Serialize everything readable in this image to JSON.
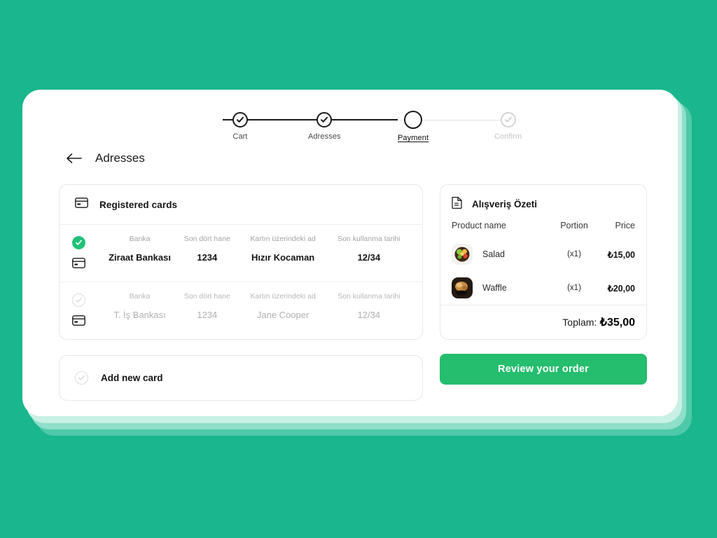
{
  "theme": {
    "background": "#1ab68e",
    "panel": "#ffffff",
    "accent_green": "#21c179",
    "button_green": "#25bd6e",
    "muted_text": "#a3a3a3"
  },
  "stepper": {
    "steps": [
      {
        "label": "Cart",
        "state": "completed",
        "icon": "check-icon"
      },
      {
        "label": "Adresses",
        "state": "completed",
        "icon": "check-icon"
      },
      {
        "label": "Payment",
        "state": "active",
        "icon": "empty-circle-icon"
      },
      {
        "label": "Confirm",
        "state": "upcoming",
        "icon": "check-icon"
      }
    ]
  },
  "header": {
    "back_icon": "arrow-left-icon",
    "title": "Adresses"
  },
  "registered_cards": {
    "icon": "credit-card-icon",
    "title": "Registered cards",
    "columns": [
      "Banka",
      "Son dört hane",
      "Kartın üzerindeki ad",
      "Son kullanma tarihi"
    ],
    "rows": [
      {
        "selected": true,
        "bank": "Ziraat Bankası",
        "last_four": "1234",
        "name_on_card": "Hızır Kocaman",
        "expiry": "12/34"
      },
      {
        "selected": false,
        "bank": "T. İş Bankası",
        "last_four": "1234",
        "name_on_card": "Jane Cooper",
        "expiry": "12/34"
      }
    ]
  },
  "add_new_card": {
    "icon": "check-circle-outline-icon",
    "label": "Add new card"
  },
  "summary": {
    "icon": "document-icon",
    "title": "Alışveriş Özeti",
    "columns": {
      "name": "Product name",
      "portion": "Portion",
      "price": "Price"
    },
    "items": [
      {
        "name": "Salad",
        "portion": "(x1)",
        "price": "₺15,00",
        "thumb": "salad-photo"
      },
      {
        "name": "Waffle",
        "portion": "(x1)",
        "price": "₺20,00",
        "thumb": "waffle-photo"
      }
    ],
    "total_label": "Toplam:",
    "total_value": "₺35,00"
  },
  "actions": {
    "review_order": "Review your order"
  }
}
